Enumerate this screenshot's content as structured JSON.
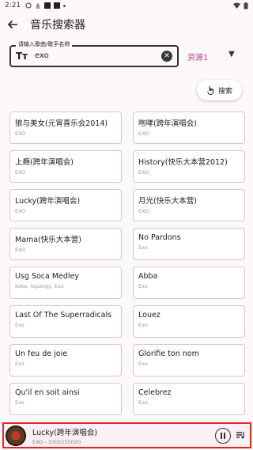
{
  "status": {
    "time": "2:21"
  },
  "appbar": {
    "title": "音乐搜索器"
  },
  "search": {
    "legend": "请输入歌曲/歌手名称",
    "value": "exo",
    "text_icon": "Tт"
  },
  "source": {
    "label": "资源1"
  },
  "search_button": {
    "label": "搜索"
  },
  "results": [
    {
      "title": "狼与美女(元宵喜乐会2014)",
      "artist": "EXO"
    },
    {
      "title": "咆哮(跨年演唱会)",
      "artist": "EXO"
    },
    {
      "title": "上瘾(跨年演唱会)",
      "artist": "EXO"
    },
    {
      "title": "History(快乐大本营2012)",
      "artist": "EXO"
    },
    {
      "title": "Lucky(跨年演唱会)",
      "artist": "EXO"
    },
    {
      "title": "月光(快乐大本营)",
      "artist": "EXO"
    },
    {
      "title": "Mama(快乐大本营)",
      "artist": "EXO"
    },
    {
      "title": "No Pardons",
      "artist": "Exo"
    },
    {
      "title": "Usg Soca Medley",
      "artist": "Koke, Squingy, Exo"
    },
    {
      "title": "Abba",
      "artist": "Exo"
    },
    {
      "title": "Last Of The Superradicals",
      "artist": "Exo"
    },
    {
      "title": "Louez",
      "artist": "Exo"
    },
    {
      "title": "Un feu de joie",
      "artist": "Exo"
    },
    {
      "title": "Glorifie ton nom",
      "artist": "Exo"
    },
    {
      "title": "Qu'il en soit ainsi",
      "artist": "Exo"
    },
    {
      "title": "Celebrez",
      "artist": "Exo"
    }
  ],
  "player": {
    "title": "Lucky(跨年演唱会)",
    "subtitle": "EXO - 1002255020"
  },
  "colors": {
    "accent": "#b0489a",
    "highlight_border": "#e0261f"
  }
}
